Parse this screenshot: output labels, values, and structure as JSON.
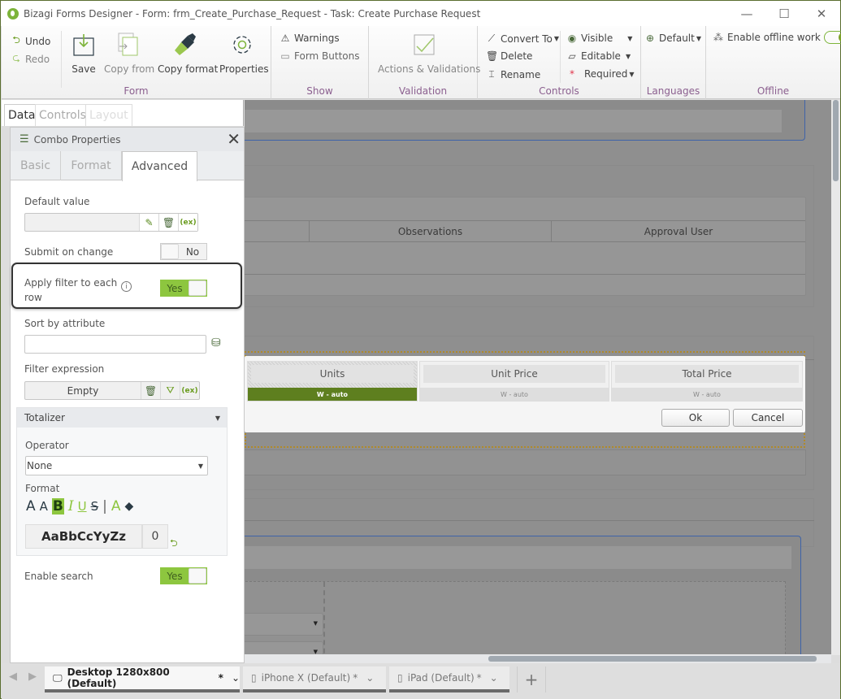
{
  "window": {
    "title": "Bizagi Forms Designer  - Form: frm_Create_Purchase_Request - Task:  Create Purchase Request",
    "minimize": "—",
    "maximize": "☐",
    "close": "✕"
  },
  "ribbon": {
    "form_group": {
      "label": "Form",
      "undo": "Undo",
      "redo": "Redo",
      "save": "Save",
      "copy_from": "Copy from",
      "copy_format": "Copy format",
      "properties": "Properties"
    },
    "show_group": {
      "label": "Show",
      "warnings": "Warnings",
      "form_buttons": "Form Buttons"
    },
    "validation_group": {
      "label": "Validation",
      "actions": "Actions & Validations"
    },
    "controls_group": {
      "label": "Controls",
      "convert_to": "Convert To",
      "delete": "Delete",
      "rename": "Rename",
      "visible": "Visible",
      "editable": "Editable",
      "required": "Required"
    },
    "languages_group": {
      "label": "Languages",
      "default": "Default"
    },
    "offline_group": {
      "label": "Offline",
      "enable_offline": "Enable offline work",
      "enable_offline_on": true
    }
  },
  "panel_tabs": [
    "Data",
    "Controls",
    "Layout"
  ],
  "combo_properties": {
    "title": "Combo Properties",
    "tabs": [
      "Basic",
      "Format",
      "Advanced"
    ],
    "active_tab": "Advanced",
    "default_value": {
      "label": "Default value",
      "value": ""
    },
    "submit_on_change": {
      "label": "Submit on change",
      "value": "No"
    },
    "apply_filter": {
      "label_line1": "Apply filter to each",
      "label_line2": "row",
      "value": "Yes"
    },
    "sort_by": {
      "label": "Sort by attribute",
      "value": ""
    },
    "filter_expression": {
      "label": "Filter expression",
      "value": "Empty"
    },
    "totalizer": {
      "label": "Totalizer",
      "operator_label": "Operator",
      "operator_value": "None",
      "format_label": "Format",
      "sample_text": "AaBbCcYyZz",
      "decimals": "0"
    },
    "enable_search": {
      "label": "Enable search",
      "value": "Yes"
    }
  },
  "canvas": {
    "grid_headers": [
      "Observations",
      "Approval User"
    ],
    "column_dialog": {
      "columns": [
        {
          "name": "Units",
          "width": "W - auto",
          "selected": true
        },
        {
          "name": "Unit Price",
          "width": "W - auto",
          "selected": false
        },
        {
          "name": "Total Price",
          "width": "W - auto",
          "selected": false
        }
      ],
      "ok": "Ok",
      "cancel": "Cancel"
    }
  },
  "device_tabs": [
    {
      "label": "Desktop 1280x800 (Default)",
      "modified": "*",
      "active": true
    },
    {
      "label": "iPhone X (Default)",
      "modified": "*",
      "active": false
    },
    {
      "label": "iPad (Default)",
      "modified": "*",
      "active": false
    }
  ],
  "add_tab": "+",
  "colors": {
    "accent_green": "#8dc63f",
    "dark_green": "#5e7f1f",
    "group_label": "#8b5f8f"
  }
}
